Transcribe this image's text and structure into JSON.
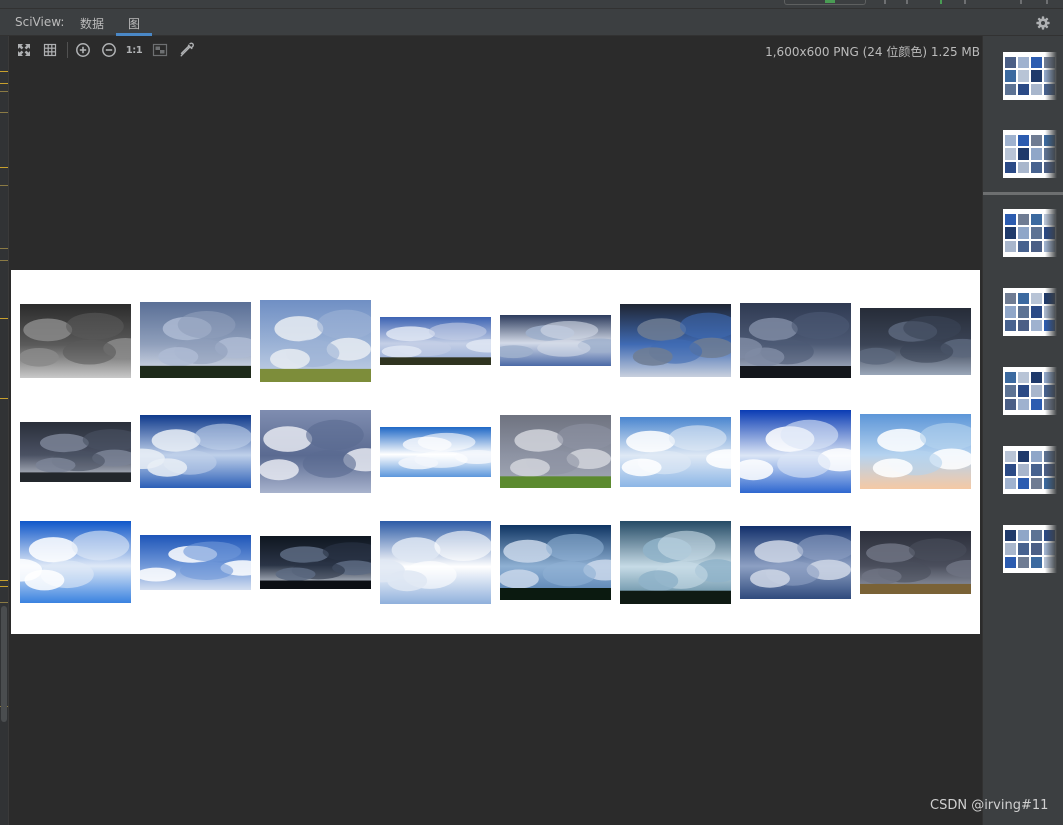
{
  "header": {
    "title": "SciView:",
    "tabs": [
      {
        "label": "数据",
        "active": false
      },
      {
        "label": "图",
        "active": true
      }
    ]
  },
  "toolbar": {
    "buttons": [
      {
        "name": "fit-to-window",
        "icon": "fit-icon"
      },
      {
        "name": "grid-toggle",
        "icon": "grid-icon"
      },
      {
        "name": "zoom-in",
        "icon": "zoom-in-icon"
      },
      {
        "name": "zoom-out",
        "icon": "zoom-out-icon"
      },
      {
        "name": "actual-size",
        "icon": "actual-size-icon",
        "label": "1:1"
      },
      {
        "name": "chessboard",
        "icon": "chessboard-icon"
      },
      {
        "name": "color-picker",
        "icon": "eyedropper-icon"
      }
    ],
    "image_info": "1,600x600 PNG (24 位颜色) 1.25 MB"
  },
  "image": {
    "rows": 3,
    "columns": 8,
    "tiles": [
      {
        "row": 1,
        "col": 1,
        "sky": [
          "#2b2b2b",
          "#8a8a8a",
          "#c9c9c9",
          "#5a5a5a"
        ],
        "ground": null
      },
      {
        "row": 1,
        "col": 2,
        "sky": [
          "#5a6f96",
          "#aebbd3",
          "#dfe4ee",
          "#8f9fbb"
        ],
        "ground": "#1e2a1a"
      },
      {
        "row": 1,
        "col": 3,
        "sky": [
          "#6f8fc4",
          "#e7ecf2",
          "#c5d2e6",
          "#9cb3d6"
        ],
        "ground": "#7d8d3a"
      },
      {
        "row": 1,
        "col": 4,
        "sky": [
          "#3d63b3",
          "#dfe6f3",
          "#8ea6d4",
          "#c4cfe6"
        ],
        "ground": "#2f3420"
      },
      {
        "row": 1,
        "col": 5,
        "sky": [
          "#2c3b5c",
          "#9fb0cd",
          "#4b6aa6",
          "#d3dae8"
        ],
        "ground": null
      },
      {
        "row": 1,
        "col": 6,
        "sky": [
          "#1f2533",
          "#6f7c93",
          "#c8d0dd",
          "#3f6ab3"
        ],
        "ground": null
      },
      {
        "row": 1,
        "col": 7,
        "sky": [
          "#2f3a52",
          "#7f8ba3",
          "#b8c1d2",
          "#4d5a75"
        ],
        "ground": "#14171c"
      },
      {
        "row": 1,
        "col": 8,
        "sky": [
          "#262c38",
          "#5c677c",
          "#9aa6b8",
          "#3b4456"
        ],
        "ground": null
      },
      {
        "row": 2,
        "col": 1,
        "sky": [
          "#2a2f3a",
          "#7b8496",
          "#c9ced8",
          "#4a5163"
        ],
        "ground": "#23272c"
      },
      {
        "row": 2,
        "col": 2,
        "sky": [
          "#0f3a8c",
          "#e9eef6",
          "#2c5fb7",
          "#bfd0ea"
        ],
        "ground": null
      },
      {
        "row": 2,
        "col": 3,
        "sky": [
          "#7f8db0",
          "#e6e9f1",
          "#a8b3cd",
          "#5a6a91"
        ],
        "ground": null
      },
      {
        "row": 2,
        "col": 4,
        "sky": [
          "#1f68c6",
          "#f2f6fb",
          "#5c97dc",
          "#ffffff"
        ],
        "ground": null
      },
      {
        "row": 2,
        "col": 5,
        "sky": [
          "#6f7380",
          "#d2d5dc",
          "#a4a9b6",
          "#8d93a3"
        ],
        "ground": "#5c8a2f"
      },
      {
        "row": 2,
        "col": 6,
        "sky": [
          "#4a86cf",
          "#ffffff",
          "#8cb6e6",
          "#dfe9f5"
        ],
        "ground": null
      },
      {
        "row": 2,
        "col": 7,
        "sky": [
          "#0a3cb4",
          "#ffffff",
          "#2e67d0",
          "#dce6f6"
        ],
        "ground": null
      },
      {
        "row": 2,
        "col": 8,
        "sky": [
          "#5d96d8",
          "#ffffff",
          "#f5c9a4",
          "#b6d3ef"
        ],
        "ground": null
      },
      {
        "row": 3,
        "col": 1,
        "sky": [
          "#0f57c9",
          "#ffffff",
          "#3a82e0",
          "#dfe9f7"
        ],
        "ground": null
      },
      {
        "row": 3,
        "col": 2,
        "sky": [
          "#1e55b8",
          "#ffffff",
          "#d4dff0",
          "#6f97d8"
        ],
        "ground": null
      },
      {
        "row": 3,
        "col": 3,
        "sky": [
          "#0f1620",
          "#5d6b82",
          "#d9dfe8",
          "#2a3446"
        ],
        "ground": "#0c0f14"
      },
      {
        "row": 3,
        "col": 4,
        "sky": [
          "#2c5ba6",
          "#dfe7f3",
          "#8fb0dc",
          "#ffffff"
        ],
        "ground": null
      },
      {
        "row": 3,
        "col": 5,
        "sky": [
          "#0f3563",
          "#c9d7ea",
          "#4c79ad",
          "#8fb0d3"
        ],
        "ground": "#0b1a10"
      },
      {
        "row": 3,
        "col": 6,
        "sky": [
          "#254b66",
          "#8fb3c9",
          "#4f7d96",
          "#c6dbe6"
        ],
        "ground": "#0f1a14"
      },
      {
        "row": 3,
        "col": 7,
        "sky": [
          "#12306b",
          "#cfd7e6",
          "#2f4a7d",
          "#8da0c3"
        ],
        "ground": null
      },
      {
        "row": 3,
        "col": 8,
        "sky": [
          "#2b2e3a",
          "#6e7383",
          "#9aa0ae",
          "#4a4e5c"
        ],
        "ground": "#7a6236"
      }
    ]
  },
  "thumbnails": [
    {
      "name": "thumb-1",
      "selected": false
    },
    {
      "name": "thumb-2",
      "selected": false
    },
    {
      "name": "thumb-3",
      "selected": false
    },
    {
      "name": "thumb-4",
      "selected": false
    },
    {
      "name": "thumb-5",
      "selected": false
    },
    {
      "name": "thumb-6",
      "selected": false
    },
    {
      "name": "thumb-7",
      "selected": false
    }
  ],
  "watermark": "CSDN @irving#11",
  "colors": {
    "background": "#2b2b2b",
    "panel": "#3c3f41",
    "accent": "#4a88c7",
    "gutter_marker": "#c8a02d"
  }
}
